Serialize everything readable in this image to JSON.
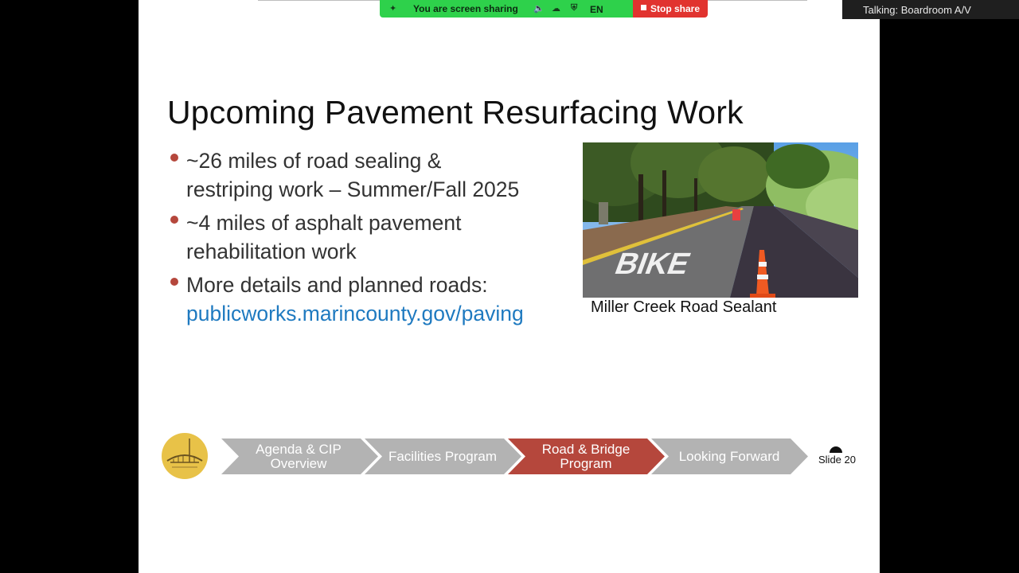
{
  "share_toolbar": {
    "status_label": "You are screen sharing",
    "language": "EN",
    "stop_label": "Stop share"
  },
  "talking_indicator": {
    "text": "Talking: Boardroom A/V"
  },
  "slide": {
    "title": "Upcoming Pavement Resurfacing Work",
    "bullets": [
      {
        "line1": "~26 miles of road sealing &",
        "line2": "restriping work – Summer/Fall 2025"
      },
      {
        "line1": "~4 miles of asphalt pavement",
        "line2": "rehabilitation work"
      },
      {
        "line1": "More details and planned roads:",
        "link": "publicworks.marincounty.gov/paving"
      }
    ],
    "photo": {
      "road_marking": "BIKE",
      "caption": "Miller Creek Road Sealant"
    },
    "nav_steps": [
      {
        "line1": "Agenda & CIP",
        "line2": "Overview",
        "active": false
      },
      {
        "line1": "Facilities Program",
        "line2": "",
        "active": false
      },
      {
        "line1": "Road & Bridge",
        "line2": "Program",
        "active": true
      },
      {
        "line1": "Looking Forward",
        "line2": "",
        "active": false
      }
    ],
    "slide_number": "Slide 20"
  },
  "colors": {
    "share_green": "#2ed14b",
    "stop_red": "#e1332f",
    "bullet_dot": "#b5473c",
    "link_blue": "#1f7ac0",
    "step_gray": "#b3b3b3",
    "step_active": "#b5473c",
    "logo_gold": "#e8c248"
  }
}
